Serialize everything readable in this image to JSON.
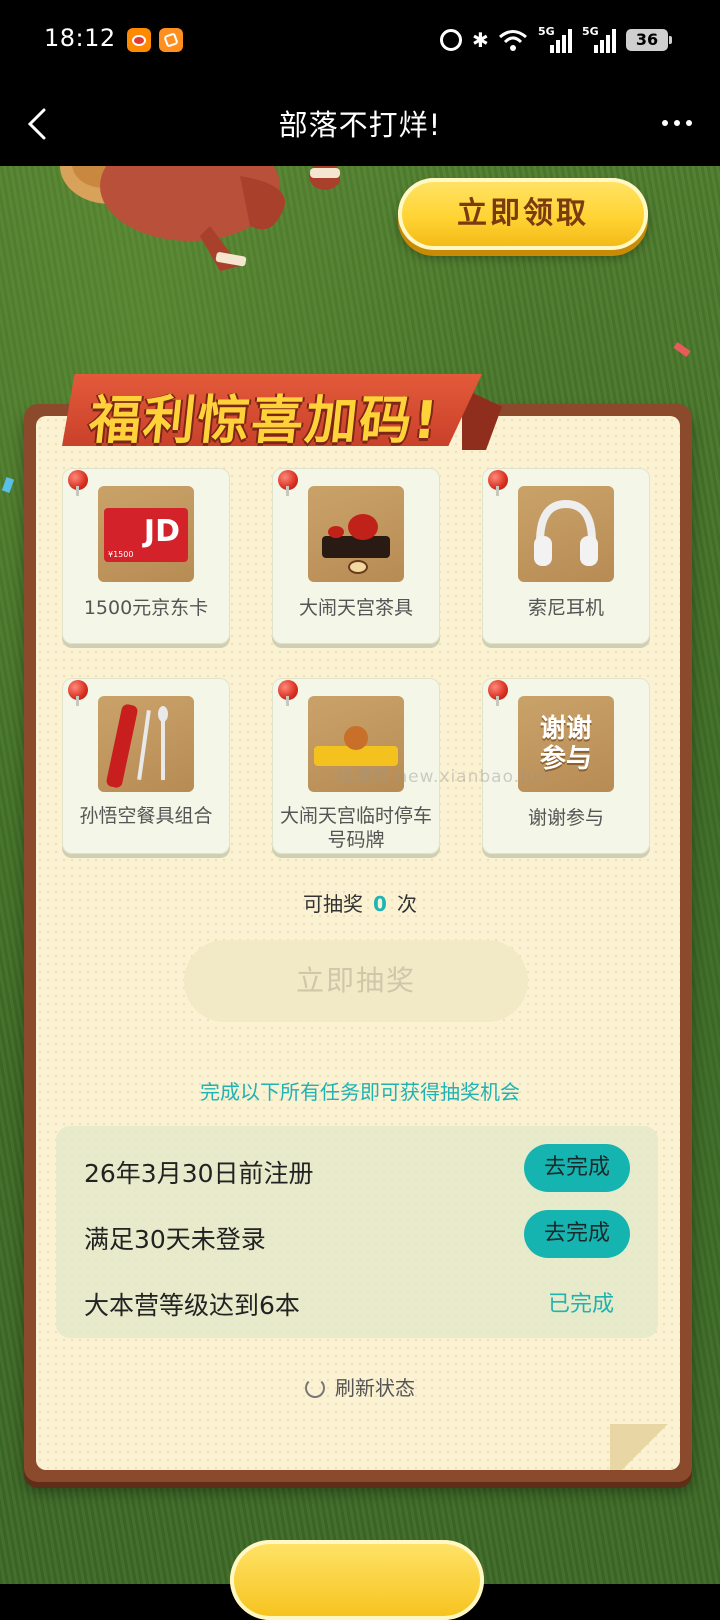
{
  "status_bar": {
    "time": "18:12",
    "battery": "36",
    "network": "5G"
  },
  "nav": {
    "title": "部落不打烊!"
  },
  "hero": {
    "claim_button": "立即领取"
  },
  "panel": {
    "title": "福利惊喜加码!",
    "prizes": [
      {
        "label": "1500元京东卡",
        "image_text": "JD",
        "image_subtext": "¥1500"
      },
      {
        "label": "大闹天宫茶具"
      },
      {
        "label": "索尼耳机"
      },
      {
        "label": "孙悟空餐具组合"
      },
      {
        "label": "大闹天宫临时停车号码牌"
      },
      {
        "label": "谢谢参与",
        "image_text": "谢谢参与"
      }
    ],
    "draw_count_prefix": "可抽奖",
    "draw_count": "0",
    "draw_count_suffix": "次",
    "draw_button": "立即抽奖",
    "task_hint": "完成以下所有任务即可获得抽奖机会",
    "tasks": [
      {
        "label": "26年3月30日前注册",
        "action": "去完成"
      },
      {
        "label": "满足30天未登录",
        "action": "去完成"
      },
      {
        "label": "大本营等级达到6本",
        "status": "已完成"
      }
    ],
    "refresh_label": "刷新状态"
  },
  "watermark": "线报酷 new.xianbao.fun",
  "colors": {
    "accent_teal": "#16b4b0",
    "ribbon_red": "#d34a30",
    "button_yellow": "#ffd433"
  }
}
